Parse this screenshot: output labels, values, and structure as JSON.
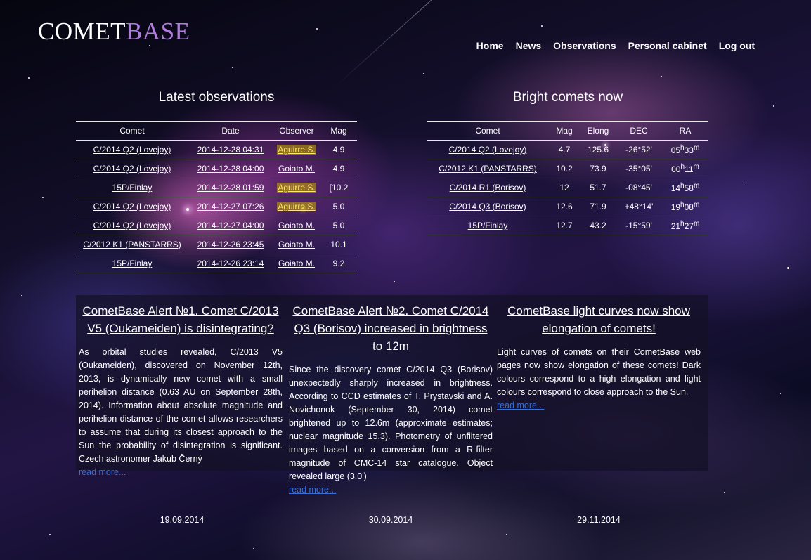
{
  "logo": {
    "part1": "COMET",
    "part2": "BASE"
  },
  "nav": [
    "Home",
    "News",
    "Observations",
    "Personal cabinet",
    "Log out"
  ],
  "latest": {
    "title": "Latest observations",
    "headers": [
      "Comet",
      "Date",
      "Observer",
      "Mag"
    ],
    "rows": [
      [
        "C/2014 Q2 (Lovejoy)",
        "2014-12-28 04:31",
        "Aguirre S.",
        "4.9"
      ],
      [
        "C/2014 Q2 (Lovejoy)",
        "2014-12-28 04:00",
        "Goiato M.",
        "4.9"
      ],
      [
        "15P/Finlay",
        "2014-12-28 01:59",
        "Aguirre S.",
        "[10.2"
      ],
      [
        "C/2014 Q2 (Lovejoy)",
        "2014-12-27 07:26",
        "Aguirre S.",
        "5.0"
      ],
      [
        "C/2014 Q2 (Lovejoy)",
        "2014-12-27 04:00",
        "Goiato M.",
        "5.0"
      ],
      [
        "C/2012 K1 (PANSTARRS)",
        "2014-12-26 23:45",
        "Goiato M.",
        "10.1"
      ],
      [
        "15P/Finlay",
        "2014-12-26 23:14",
        "Goiato M.",
        "9.2"
      ]
    ]
  },
  "bright": {
    "title": "Bright comets now",
    "headers": [
      "Comet",
      "Mag",
      "Elong",
      "DEC",
      "RA"
    ],
    "rows": [
      [
        "C/2014 Q2 (Lovejoy)",
        "4.7",
        "125.6",
        "-26°52'",
        "05",
        "33"
      ],
      [
        "C/2012 K1 (PANSTARRS)",
        "10.2",
        "73.9",
        "-35°05'",
        "00",
        "11"
      ],
      [
        "C/2014 R1 (Borisov)",
        "12",
        "51.7",
        "-08°45'",
        "14",
        "58"
      ],
      [
        "C/2014 Q3 (Borisov)",
        "12.6",
        "71.9",
        "+48°14'",
        "19",
        "08"
      ],
      [
        "15P/Finlay",
        "12.7",
        "43.2",
        "-15°59'",
        "21",
        "27"
      ]
    ],
    "ra_hour_unit": "h",
    "ra_min_unit": "m"
  },
  "news": [
    {
      "title": "CometBase Alert №1. Comet C/2013 V5 (Oukameiden) is disintegrating?",
      "body": "As orbital studies revealed, C/2013 V5 (Oukameiden), discovered on November 12th, 2013, is dynamically new comet with a small perihelion distance (0.63 AU on September 28th, 2014). Information about absolute magnitude and perihelion distance of the comet allows researchers to assume that during its closest approach to the Sun the probability of disintegration is significant. Czech astronomer Jakub Černý",
      "more": "read more...",
      "date": "19.09.2014"
    },
    {
      "title": "CometBase Alert №2. Comet C/2014 Q3 (Borisov) increased in brightness to 12m",
      "body": "Since the discovery comet C/2014 Q3 (Borisov) unexpectedly sharply increased in brightness. According to CCD estimates of T. Prystavski and A. Novichonok (September 30, 2014) comet brightened up to 12.6m (approximate estimates; nuclear magnitude 15.3). Photometry of unfiltered images based on a conversion from a R-filter magnitude of CMC-14 star catalogue. Object revealed large (3.0')",
      "more": "read more...",
      "date": "30.09.2014"
    },
    {
      "title": "CometBase light curves now show elongation of comets!",
      "body": "Light curves of comets on their CometBase web pages now show elongation of these comets! Dark colours correspond to a high elongation and light colours correspond to close approach to the Sun.",
      "more": "read more...",
      "date": "29.11.2014"
    }
  ]
}
